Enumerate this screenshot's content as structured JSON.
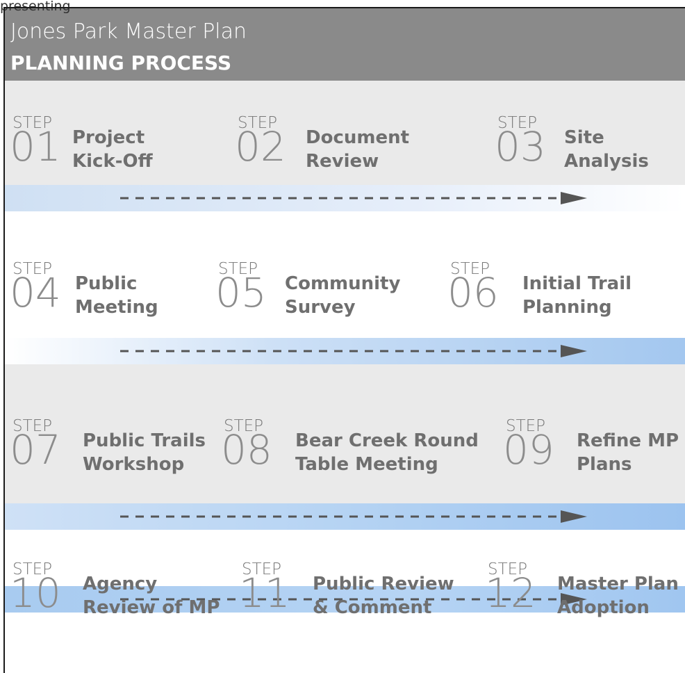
{
  "overlay_text": "presenting",
  "header": {
    "title": "Jones Park Master Plan",
    "subtitle": "PLANNING PROCESS"
  },
  "step_word": "STEP",
  "steps": [
    {
      "num": "01",
      "line1": "Project",
      "line2": "Kick-Off"
    },
    {
      "num": "02",
      "line1": "Document",
      "line2": "Review"
    },
    {
      "num": "03",
      "line1": "Site",
      "line2": "Analysis"
    },
    {
      "num": "04",
      "line1": "Public",
      "line2": "Meeting"
    },
    {
      "num": "05",
      "line1": "Community",
      "line2": "Survey"
    },
    {
      "num": "06",
      "line1": "Initial Trail",
      "line2": "Planning"
    },
    {
      "num": "07",
      "line1": "Public Trails",
      "line2": "Workshop"
    },
    {
      "num": "08",
      "line1": "Bear Creek Round",
      "line2": "Table Meeting"
    },
    {
      "num": "09",
      "line1": "Refine MP",
      "line2": "Plans"
    },
    {
      "num": "10",
      "line1": "Agency",
      "line2": "Review of MP"
    },
    {
      "num": "11",
      "line1": "Public Review",
      "line2": "& Comment"
    },
    {
      "num": "12",
      "line1": "Master Plan",
      "line2": "Adoption"
    }
  ],
  "colors": {
    "header_bg": "#8a8a8a",
    "grey_band": "#eaeaea",
    "arrow": "#555555",
    "bar_blue": "#a3c7ef"
  }
}
